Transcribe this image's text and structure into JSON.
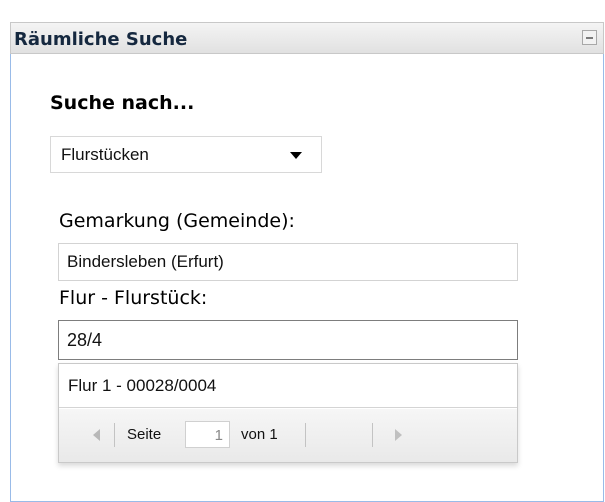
{
  "panel": {
    "title": "Räumliche Suche"
  },
  "search": {
    "section_label": "Suche nach...",
    "type_select": {
      "selected": "Flurstücken"
    },
    "gemarkung": {
      "label": "Gemarkung (Gemeinde):",
      "value": "Bindersleben (Erfurt)"
    },
    "flur": {
      "label": "Flur - Flurstück:",
      "value": "28/4"
    },
    "results": {
      "items": [
        {
          "label": "Flur 1 - 00028/0004"
        }
      ],
      "paging": {
        "page_label": "Seite",
        "current_page": "1",
        "total_label": "von 1"
      }
    }
  },
  "colors": {
    "panel_border": "#99bbe8",
    "title_text": "#15283f",
    "active_input_border": "#7d7d7d"
  },
  "icons": {
    "collapse": "minus-icon",
    "prev_page": "triangle-left-icon",
    "next_page": "triangle-right-icon",
    "select_arrow": "triangle-down-icon"
  }
}
